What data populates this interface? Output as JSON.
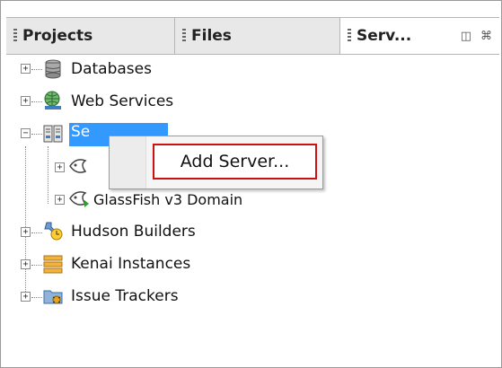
{
  "tabs": [
    {
      "label": "Projects"
    },
    {
      "label": "Files"
    },
    {
      "label": "Serv..."
    }
  ],
  "tab_controls": {
    "minimize_glyph": "◫",
    "close_glyph": "⌘"
  },
  "tree": {
    "databases": "Databases",
    "web_services": "Web Services",
    "servers": "Se",
    "glassfish_v3": "GlassFish v3 Domain",
    "hudson": "Hudson Builders",
    "kenai": "Kenai Instances",
    "issue_trackers": "Issue Trackers",
    "expand_glyph": "+",
    "collapse_glyph": "−"
  },
  "context_menu": {
    "add_server": "Add Server..."
  },
  "colors": {
    "selection": "#3399ff",
    "highlight_border": "#cc1111"
  }
}
